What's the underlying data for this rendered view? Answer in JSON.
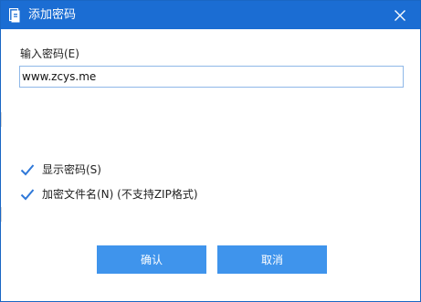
{
  "window": {
    "title": "添加密码",
    "title_icon": "document-lock-icon",
    "close_icon": "close-icon",
    "titlebar_color": "#1b6dd3"
  },
  "password": {
    "label": "输入密码(E)",
    "value": "www.zcys.me"
  },
  "options": [
    {
      "label": "显示密码(S)",
      "checked": true
    },
    {
      "label": "加密文件名(N) (不支持ZIP格式)",
      "checked": true
    }
  ],
  "buttons": {
    "ok_label": "确认",
    "cancel_label": "取消",
    "button_color": "#3f94ec"
  }
}
